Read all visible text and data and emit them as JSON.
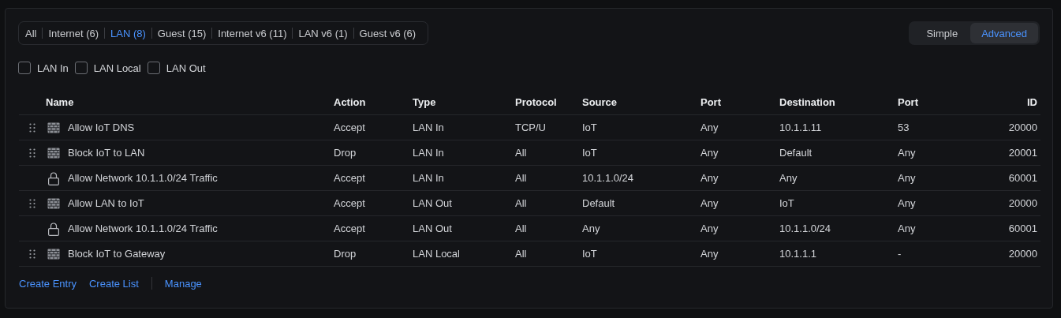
{
  "filter_tabs": [
    {
      "label": "All",
      "selected": false
    },
    {
      "label": "Internet (6)",
      "selected": false
    },
    {
      "label": "LAN (8)",
      "selected": true
    },
    {
      "label": "Guest (15)",
      "selected": false
    },
    {
      "label": "Internet v6 (11)",
      "selected": false
    },
    {
      "label": "LAN v6 (1)",
      "selected": false
    },
    {
      "label": "Guest v6 (6)",
      "selected": false
    }
  ],
  "view_toggle": [
    {
      "label": "Simple",
      "selected": false
    },
    {
      "label": "Advanced",
      "selected": true
    }
  ],
  "checkboxes": [
    {
      "label": "LAN In",
      "checked": false
    },
    {
      "label": "LAN Local",
      "checked": false
    },
    {
      "label": "LAN Out",
      "checked": false
    }
  ],
  "table": {
    "columns": [
      "Name",
      "Action",
      "Type",
      "Protocol",
      "Source",
      "Port",
      "Destination",
      "Port",
      "ID"
    ],
    "rows": [
      {
        "kind": "rule",
        "cells": [
          "Allow IoT DNS",
          "Accept",
          "LAN In",
          "TCP/U",
          "IoT",
          "Any",
          "10.1.1.11",
          "53",
          "20000"
        ]
      },
      {
        "kind": "rule",
        "cells": [
          "Block IoT to LAN",
          "Drop",
          "LAN In",
          "All",
          "IoT",
          "Any",
          "Default",
          "Any",
          "20001"
        ]
      },
      {
        "kind": "locked",
        "cells": [
          "Allow Network 10.1.1.0/24 Traffic",
          "Accept",
          "LAN In",
          "All",
          "10.1.1.0/24",
          "Any",
          "Any",
          "Any",
          "60001"
        ]
      },
      {
        "kind": "rule",
        "cells": [
          "Allow LAN to IoT",
          "Accept",
          "LAN Out",
          "All",
          "Default",
          "Any",
          "IoT",
          "Any",
          "20000"
        ]
      },
      {
        "kind": "locked",
        "cells": [
          "Allow Network 10.1.1.0/24 Traffic",
          "Accept",
          "LAN Out",
          "All",
          "Any",
          "Any",
          "10.1.1.0/24",
          "Any",
          "60001"
        ]
      },
      {
        "kind": "rule",
        "cells": [
          "Block IoT to Gateway",
          "Drop",
          "LAN Local",
          "All",
          "IoT",
          "Any",
          "10.1.1.1",
          "-",
          "20000"
        ]
      }
    ]
  },
  "footer_links": [
    {
      "label": "Create Entry",
      "divider_before": false
    },
    {
      "label": "Create List",
      "divider_before": false
    },
    {
      "label": "Manage",
      "divider_before": true
    }
  ]
}
